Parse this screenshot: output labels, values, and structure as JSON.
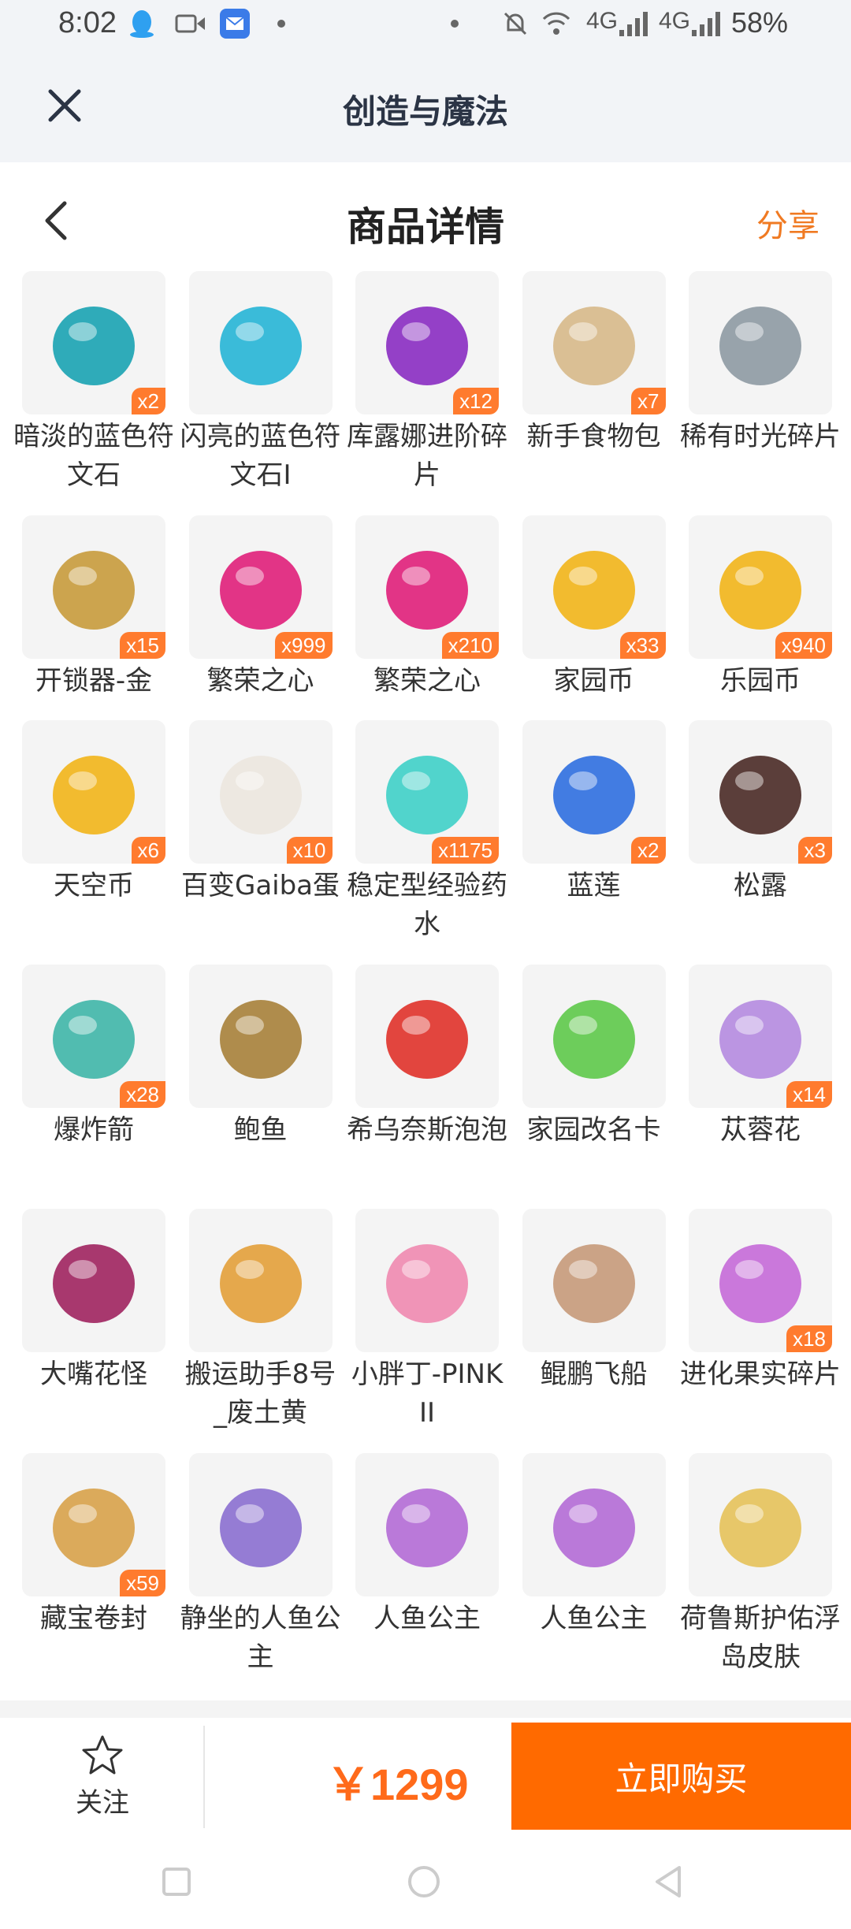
{
  "status_bar": {
    "time": "8:02",
    "network_1": "4G",
    "network_2": "4G",
    "battery": "58%"
  },
  "app_bar": {
    "title": "创造与魔法"
  },
  "sub_header": {
    "title": "商品详情",
    "share": "分享"
  },
  "items": [
    {
      "name": "暗淡的蓝色符文石",
      "qty": "x2",
      "icon": "dark-blue-rune-stone-icon",
      "color": "#1aa3b3"
    },
    {
      "name": "闪亮的蓝色符文石I",
      "qty": "",
      "icon": "shiny-blue-rune-stone-icon",
      "color": "#26b5d6"
    },
    {
      "name": "库露娜进阶碎片",
      "qty": "x12",
      "icon": "kuluna-fragment-icon",
      "color": "#8a2cc2"
    },
    {
      "name": "新手食物包",
      "qty": "x7",
      "icon": "food-bag-icon",
      "color": "#d7b98a"
    },
    {
      "name": "稀有时光碎片",
      "qty": "",
      "icon": "time-fragment-icon",
      "color": "#8e9aa3"
    },
    {
      "name": "开锁器-金",
      "qty": "x15",
      "icon": "golden-keys-icon",
      "color": "#c89b3c"
    },
    {
      "name": "繁荣之心",
      "qty": "x999",
      "icon": "prosperity-heart-icon",
      "color": "#e01f7a"
    },
    {
      "name": "繁荣之心",
      "qty": "x210",
      "icon": "prosperity-heart-icon",
      "color": "#e01f7a"
    },
    {
      "name": "家园币",
      "qty": "x33",
      "icon": "home-coin-icon",
      "color": "#f2b51a"
    },
    {
      "name": "乐园币",
      "qty": "x940",
      "icon": "paradise-coin-icon",
      "color": "#f2b51a"
    },
    {
      "name": "天空币",
      "qty": "x6",
      "icon": "sky-coin-icon",
      "color": "#f2b51a"
    },
    {
      "name": "百变Gaiba蛋",
      "qty": "x10",
      "icon": "gaiba-egg-icon",
      "color": "#ece7df"
    },
    {
      "name": "稳定型经验药水",
      "qty": "x1175",
      "icon": "exp-potion-icon",
      "color": "#3fd0c8"
    },
    {
      "name": "蓝莲",
      "qty": "x2",
      "icon": "blue-lotus-icon",
      "color": "#2f6fe0"
    },
    {
      "name": "松露",
      "qty": "x3",
      "icon": "truffle-icon",
      "color": "#4a2a26"
    },
    {
      "name": "爆炸箭",
      "qty": "x28",
      "icon": "explosive-arrow-icon",
      "color": "#3fb6a8"
    },
    {
      "name": "鲍鱼",
      "qty": "",
      "icon": "abalone-icon",
      "color": "#a7813a"
    },
    {
      "name": "希乌奈斯泡泡",
      "qty": "",
      "icon": "red-flower-bubble-icon",
      "color": "#e0322a"
    },
    {
      "name": "家园改名卡",
      "qty": "",
      "icon": "rename-card-icon",
      "color": "#5ec94a"
    },
    {
      "name": "苁蓉花",
      "qty": "x14",
      "icon": "cistanche-flower-icon",
      "color": "#b58be0"
    },
    {
      "name": "大嘴花怪",
      "qty": "",
      "icon": "piranha-plant-icon",
      "color": "#a0235f"
    },
    {
      "name": "搬运助手8号_废土黄",
      "qty": "",
      "icon": "robot-helper-icon",
      "color": "#e3a03a"
    },
    {
      "name": "小胖丁-PINK II",
      "qty": "",
      "icon": "pink-car-icon",
      "color": "#f08ab0"
    },
    {
      "name": "鲲鹏飞船",
      "qty": "",
      "icon": "airship-icon",
      "color": "#c79a7a"
    },
    {
      "name": "进化果实碎片",
      "qty": "x18",
      "icon": "fruit-fragment-icon",
      "color": "#c56ad8"
    },
    {
      "name": "藏宝卷封",
      "qty": "x59",
      "icon": "treasure-scroll-icon",
      "color": "#d8a24a"
    },
    {
      "name": "静坐的人鱼公主",
      "qty": "",
      "icon": "mermaid-princess-icon",
      "color": "#8b6fd0"
    },
    {
      "name": "人鱼公主",
      "qty": "",
      "icon": "mermaid-icon",
      "color": "#b46bd6"
    },
    {
      "name": "人鱼公主",
      "qty": "",
      "icon": "mermaid-icon",
      "color": "#b46bd6"
    },
    {
      "name": "荷鲁斯护佑浮岛皮肤",
      "qty": "",
      "icon": "floating-island-icon",
      "color": "#e6c25a"
    }
  ],
  "bottom_bar": {
    "follow_label": "关注",
    "price": "￥1299",
    "buy_label": "立即购买"
  },
  "colors": {
    "accent": "#ff6a00",
    "badge": "#ff7b2e",
    "share": "#f07a22"
  }
}
